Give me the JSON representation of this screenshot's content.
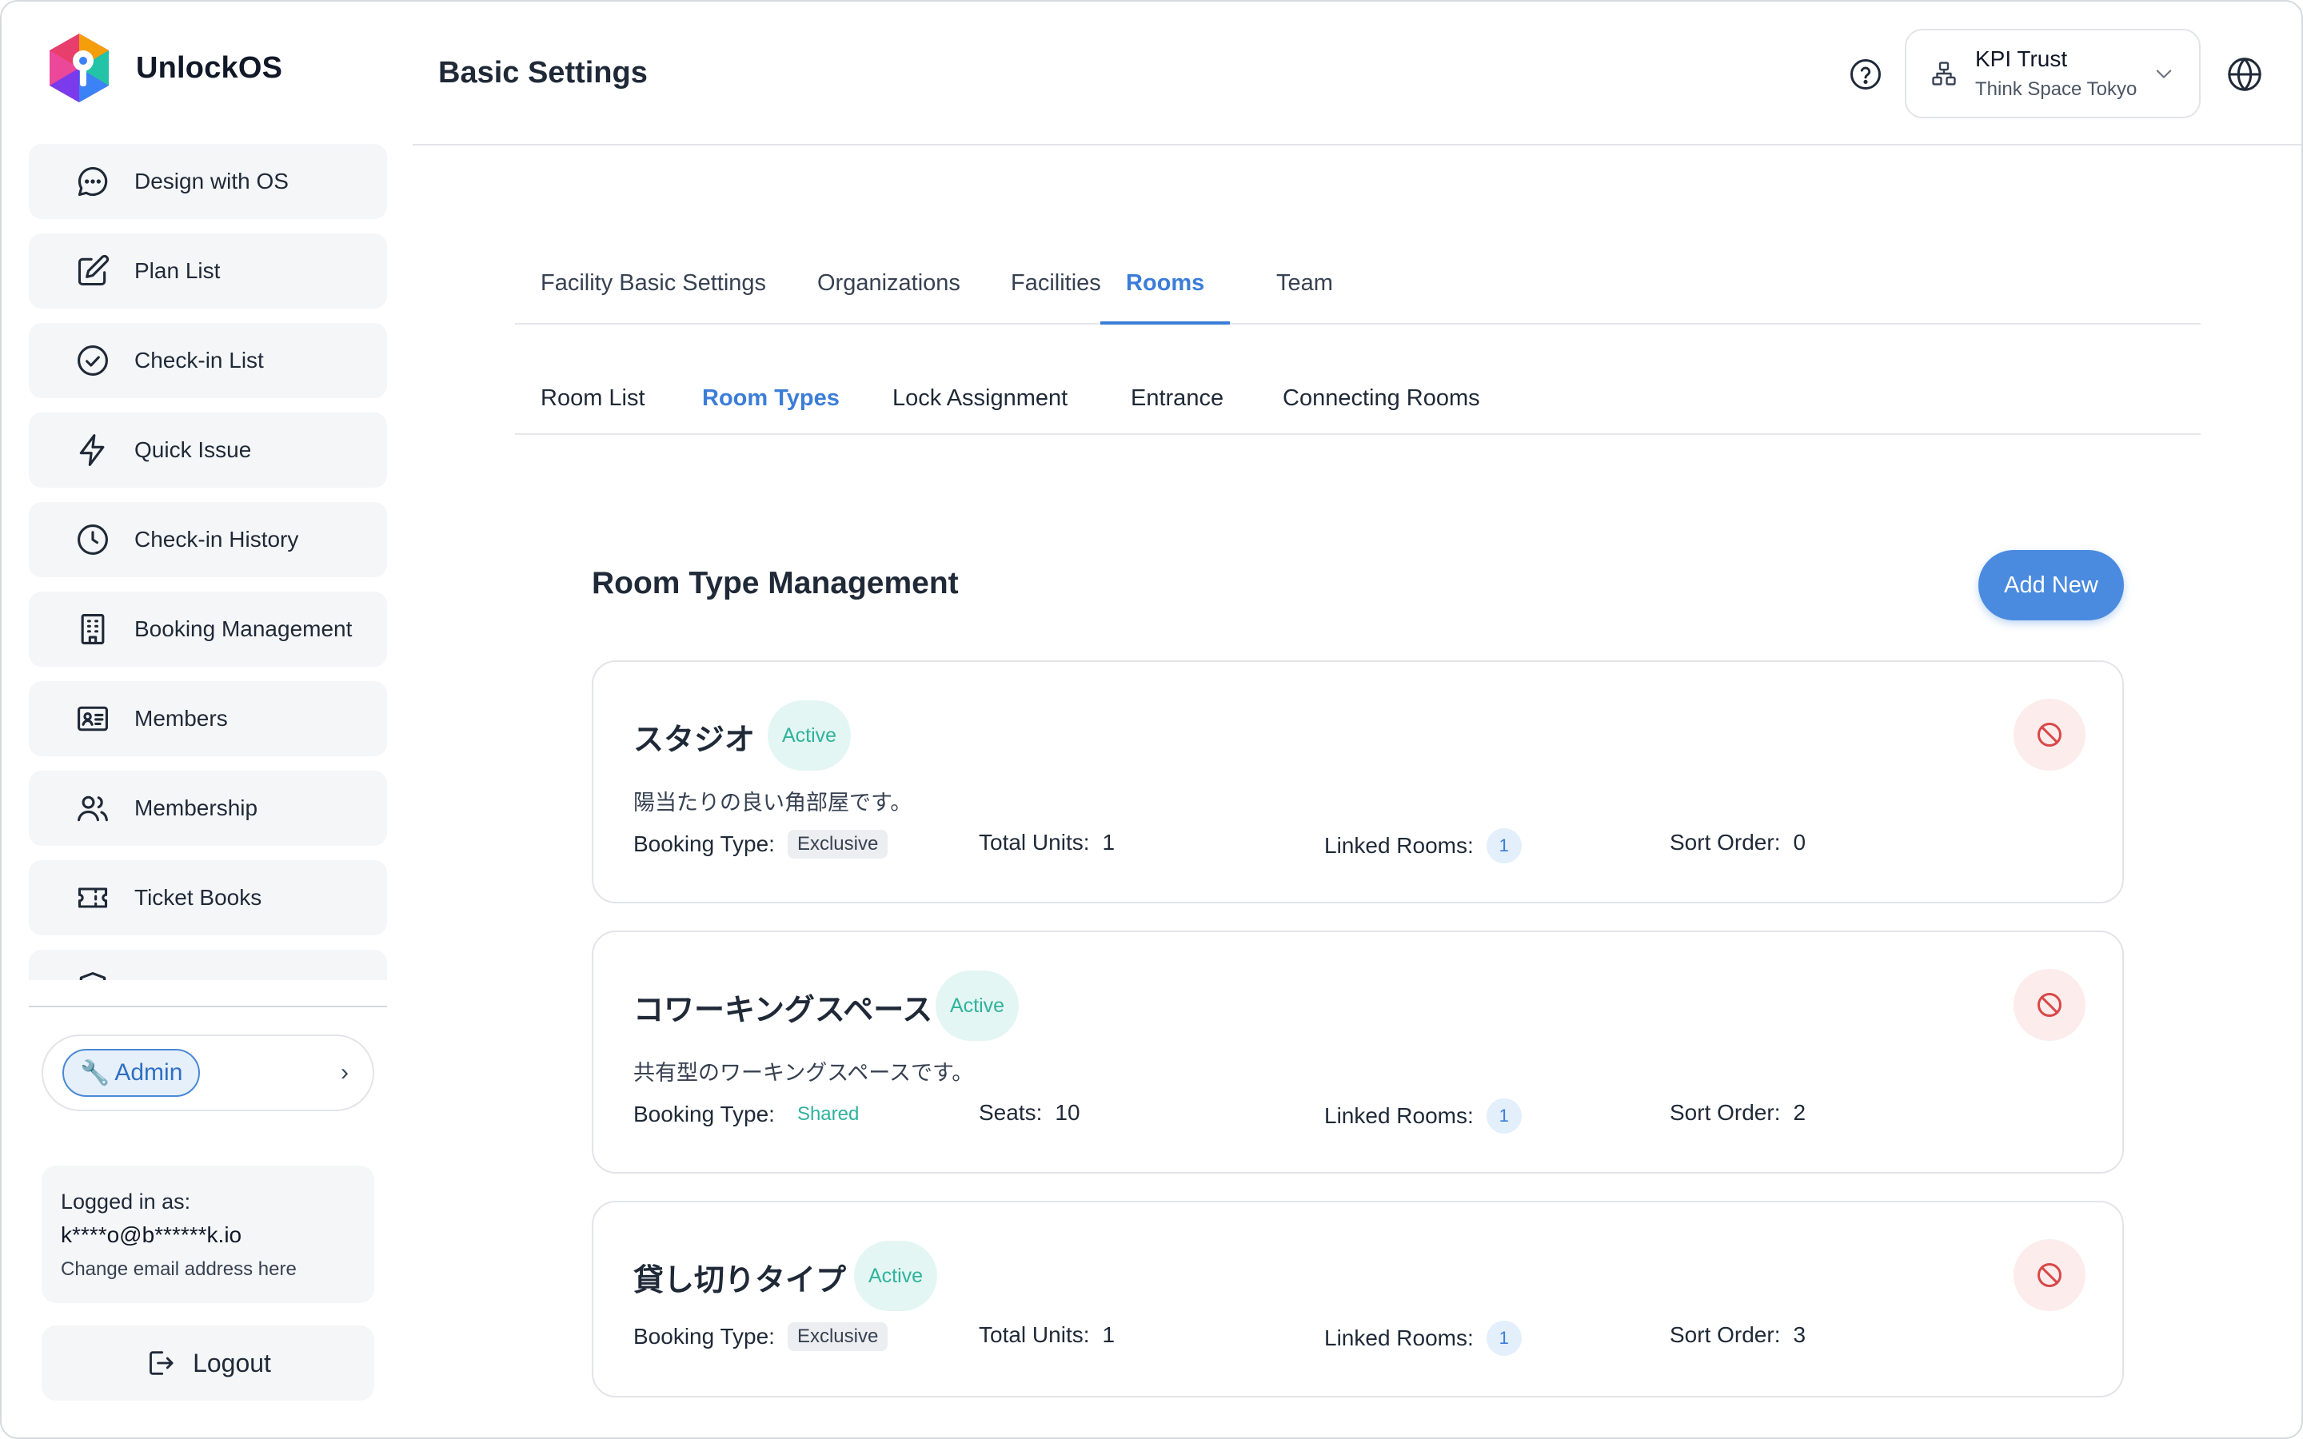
{
  "brand": {
    "name": "UnlockOS"
  },
  "sidebar": {
    "items": [
      {
        "label": "Design with OS",
        "icon": "chat-bubble-icon"
      },
      {
        "label": "Plan List",
        "icon": "edit-icon"
      },
      {
        "label": "Check-in List",
        "icon": "check-circle-icon"
      },
      {
        "label": "Quick Issue",
        "icon": "lightning-icon"
      },
      {
        "label": "Check-in History",
        "icon": "clock-icon"
      },
      {
        "label": "Booking Management",
        "icon": "building-icon"
      },
      {
        "label": "Members",
        "icon": "id-card-icon"
      },
      {
        "label": "Membership",
        "icon": "users-icon"
      },
      {
        "label": "Ticket Books",
        "icon": "ticket-icon"
      }
    ],
    "role": {
      "label": "Admin",
      "icon": "wrench-icon"
    },
    "login": {
      "label": "Logged in as:",
      "email": "k****o@b******k.io",
      "change": "Change email address here"
    },
    "logout": "Logout"
  },
  "header": {
    "title": "Basic Settings",
    "org": {
      "name": "KPI Trust",
      "sub": "Think Space Tokyo"
    }
  },
  "tabs": [
    {
      "label": "Facility Basic Settings"
    },
    {
      "label": "Organizations"
    },
    {
      "label": "Facilities"
    },
    {
      "label": "Rooms"
    },
    {
      "label": "Team"
    }
  ],
  "subtabs": [
    {
      "label": "Room List"
    },
    {
      "label": "Room Types"
    },
    {
      "label": "Lock Assignment"
    },
    {
      "label": "Entrance"
    },
    {
      "label": "Connecting Rooms"
    }
  ],
  "main": {
    "title": "Room Type Management",
    "add_label": "Add New",
    "labels": {
      "booking_type": "Booking Type:",
      "total_units": "Total Units:",
      "seats": "Seats:",
      "linked_rooms": "Linked Rooms:",
      "sort_order": "Sort Order:"
    },
    "room_types": [
      {
        "name": "スタジオ",
        "status": "Active",
        "description": "陽当たりの良い角部屋です。",
        "booking_type": "Exclusive",
        "total_units": "1",
        "linked_rooms": "1",
        "sort_order": "0"
      },
      {
        "name": "コワーキングスペース",
        "status": "Active",
        "description": "共有型のワーキングスペースです。",
        "booking_type": "Shared",
        "seats": "10",
        "linked_rooms": "1",
        "sort_order": "2"
      },
      {
        "name": "貸し切りタイプ",
        "status": "Active",
        "booking_type": "Exclusive",
        "total_units": "1",
        "linked_rooms": "1",
        "sort_order": "3"
      }
    ]
  },
  "colors": {
    "accent": "#3b7dd8",
    "active_badge": "#2fb39c",
    "danger": "#d94848"
  }
}
